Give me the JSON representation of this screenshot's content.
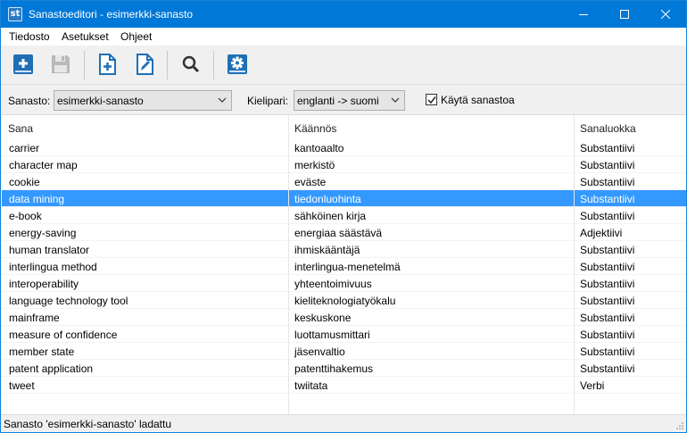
{
  "window": {
    "app_icon_text": "st",
    "title": "Sanastoeditori - esimerkki-sanasto"
  },
  "menu": [
    "Tiedosto",
    "Asetukset",
    "Ohjeet"
  ],
  "toolbar": {
    "buttons": [
      "add-word-icon",
      "save-icon",
      "new-file-icon",
      "edit-file-icon",
      "search-icon",
      "settings-icon"
    ]
  },
  "filter": {
    "sanasto_label": "Sanasto:",
    "sanasto_value": "esimerkki-sanasto",
    "kielipari_label": "Kielipari:",
    "kielipari_value": "englanti -> suomi",
    "use_label": "Käytä sanastoa",
    "use_checked": true
  },
  "table": {
    "headers": [
      "Sana",
      "Käännös",
      "Sanaluokka"
    ],
    "selected_row": 3,
    "rows": [
      [
        "carrier",
        "kantoaalto",
        "Substantiivi"
      ],
      [
        "character map",
        "merkistö",
        "Substantiivi"
      ],
      [
        "cookie",
        "eväste",
        "Substantiivi"
      ],
      [
        "data mining",
        "tiedonluohinta",
        "Substantiivi"
      ],
      [
        "e-book",
        "sähköinen kirja",
        "Substantiivi"
      ],
      [
        "energy-saving",
        "energiaa säästävä",
        "Adjektiivi"
      ],
      [
        "human translator",
        "ihmiskääntäjä",
        "Substantiivi"
      ],
      [
        "interlingua method",
        "interlingua-menetelmä",
        "Substantiivi"
      ],
      [
        "interoperability",
        "yhteentoimivuus",
        "Substantiivi"
      ],
      [
        "language technology tool",
        "kieliteknologiatyökalu",
        "Substantiivi"
      ],
      [
        "mainframe",
        "keskuskone",
        "Substantiivi"
      ],
      [
        "measure of confidence",
        "luottamusmittari",
        "Substantiivi"
      ],
      [
        "member state",
        "jäsenvaltio",
        "Substantiivi"
      ],
      [
        "patent application",
        "patenttihakemus",
        "Substantiivi"
      ],
      [
        "tweet",
        "twiitata",
        "Verbi"
      ]
    ]
  },
  "status": "Sanasto 'esimerkki-sanasto' ladattu",
  "colors": {
    "titlebar": "#0078d7",
    "selection": "#3399ff",
    "icon_blue": "#1f6fb5"
  }
}
